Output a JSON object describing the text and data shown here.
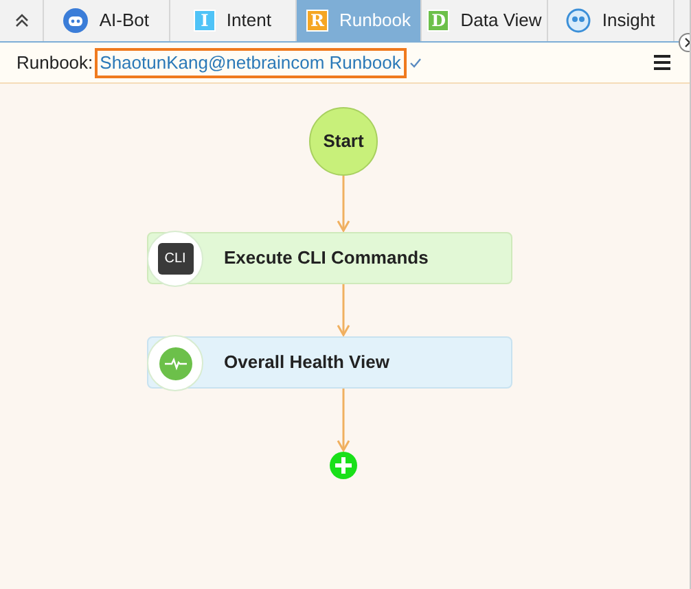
{
  "tabs": [
    {
      "label": "AI-Bot",
      "kind": "bot",
      "selected": false
    },
    {
      "label": "Intent",
      "kind": "letter",
      "letter": "I",
      "color": "#4fc3f7",
      "selected": false
    },
    {
      "label": "Runbook",
      "kind": "letter",
      "letter": "R",
      "color": "#f5a623",
      "selected": true
    },
    {
      "label": "Data View",
      "kind": "letter",
      "letter": "D",
      "color": "#6cc04a",
      "selected": false
    },
    {
      "label": "Insight",
      "kind": "insight",
      "selected": false
    }
  ],
  "runbook_bar": {
    "label": "Runbook:",
    "value": "ShaotunKang@netbraincom Runbook"
  },
  "flow": {
    "start": "Start",
    "nodes": [
      {
        "kind": "cli",
        "icon_text": "CLI",
        "title": "Execute CLI Commands"
      },
      {
        "kind": "health",
        "title": "Overall Health View"
      }
    ]
  }
}
